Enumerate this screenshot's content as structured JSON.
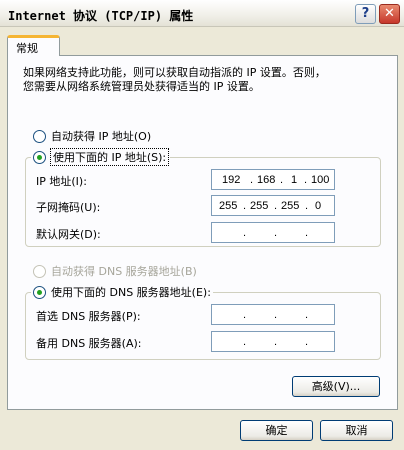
{
  "window": {
    "title": "Internet 协议 (TCP/IP) 属性",
    "help_label": "?",
    "close_label": "✕"
  },
  "tab": {
    "label": "常规"
  },
  "description": "如果网络支持此功能，则可以获取自动指派的 IP 设置。否则，\n您需要从网络系统管理员处获得适当的 IP 设置。",
  "ip_section": {
    "auto_label": "自动获得 IP 地址(O)",
    "manual_label": "使用下面的 IP 地址(S):",
    "selected": "manual",
    "fields": [
      {
        "label": "IP 地址(I):",
        "octets": [
          "192",
          "168",
          "1",
          "100"
        ]
      },
      {
        "label": "子网掩码(U):",
        "octets": [
          "255",
          "255",
          "255",
          "0"
        ]
      },
      {
        "label": "默认网关(D):",
        "octets": [
          "",
          "",
          "",
          ""
        ]
      }
    ]
  },
  "dns_section": {
    "auto_label": "自动获得 DNS 服务器地址(B)",
    "manual_label": "使用下面的 DNS 服务器地址(E):",
    "selected": "manual",
    "fields": [
      {
        "label": "首选 DNS 服务器(P):",
        "octets": [
          "",
          "",
          "",
          ""
        ]
      },
      {
        "label": "备用 DNS 服务器(A):",
        "octets": [
          "",
          "",
          "",
          ""
        ]
      }
    ]
  },
  "buttons": {
    "advanced": "高级(V)...",
    "ok": "确定",
    "cancel": "取消"
  },
  "colors": {
    "radio_selected": "#21a121",
    "tab_highlight": "#f5b533",
    "field_border": "#7f9db9"
  }
}
